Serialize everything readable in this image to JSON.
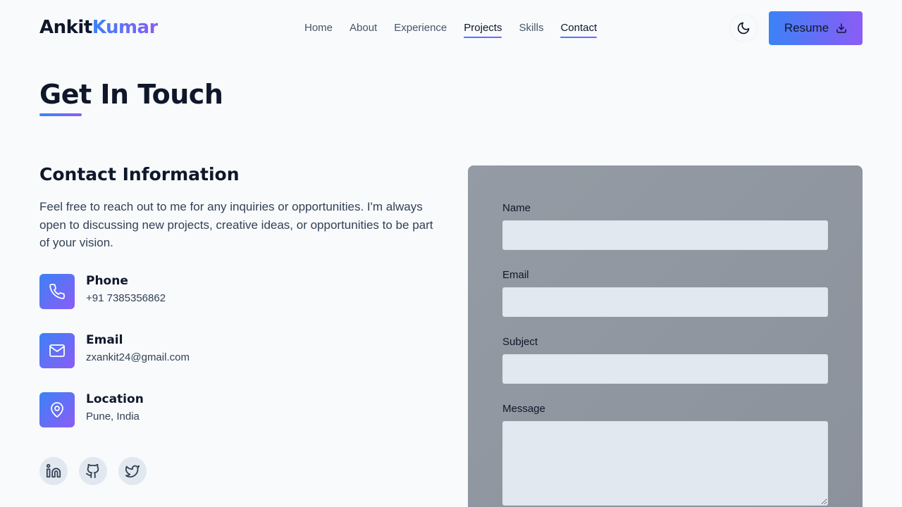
{
  "nav": {
    "logo_first": "Ankit",
    "logo_second": "Kumar",
    "links": [
      "Home",
      "About",
      "Experience",
      "Projects",
      "Skills",
      "Contact"
    ],
    "active_links": [
      "Projects",
      "Contact"
    ],
    "theme_icon": "moon-icon",
    "resume_label": "Resume",
    "resume_icon": "download-icon"
  },
  "page": {
    "title": "Get In Touch"
  },
  "contact_info": {
    "title": "Contact Information",
    "intro": "Feel free to reach out to me for any inquiries or opportunities. I'm always open to discussing new projects, creative ideas, or opportunities to be part of your vision.",
    "items": [
      {
        "label": "Phone",
        "value": "+91 7385356862",
        "icon": "phone-icon"
      },
      {
        "label": "Email",
        "value": "zxankit24@gmail.com",
        "icon": "mail-icon"
      },
      {
        "label": "Location",
        "value": "Pune, India",
        "icon": "map-pin-icon"
      }
    ],
    "socials": [
      "linkedin-icon",
      "github-icon",
      "twitter-icon"
    ]
  },
  "form": {
    "name_label": "Name",
    "name_value": "",
    "email_label": "Email",
    "email_value": "",
    "subject_label": "Subject",
    "subject_value": "",
    "message_label": "Message",
    "message_value": ""
  },
  "colors": {
    "accent_start": "#3b82f6",
    "accent_end": "#8b5cf6",
    "background": "#f8fafc",
    "form_card": "#8f969f",
    "input_bg": "#e2e8f0"
  }
}
